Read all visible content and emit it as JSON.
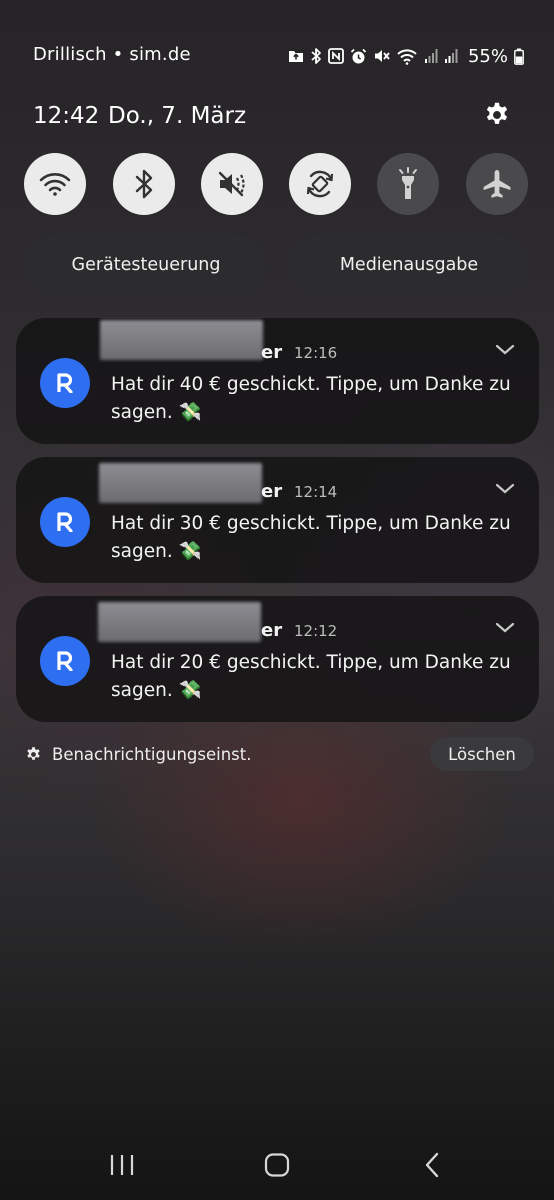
{
  "status_bar": {
    "carrier": "Drillisch • sim.de",
    "battery": "55%",
    "icons": [
      "notification-app-icon",
      "bluetooth-icon",
      "nfc-icon",
      "alarm-icon",
      "mute-icon",
      "wifi-icon",
      "signal-icon",
      "signal-icon",
      "battery-icon"
    ]
  },
  "header": {
    "time": "12:42",
    "date": "Do., 7. März",
    "settings_icon": "gear-icon"
  },
  "quick_settings": [
    {
      "name": "wifi",
      "icon": "wifi-icon",
      "on": true
    },
    {
      "name": "bluetooth",
      "icon": "bluetooth-icon",
      "on": true
    },
    {
      "name": "sound",
      "icon": "mute-icon",
      "on": true
    },
    {
      "name": "auto-rotate",
      "icon": "rotate-icon",
      "on": true
    },
    {
      "name": "flashlight",
      "icon": "flashlight-icon",
      "on": false
    },
    {
      "name": "airplane-mode",
      "icon": "airplane-icon",
      "on": false
    }
  ],
  "controls": {
    "device_control": "Gerätesteuerung",
    "media_output": "Medienausgabe"
  },
  "notifications": [
    {
      "sender_suffix": "er",
      "time": "12:16",
      "message": "Hat dir 40 € geschickt. Tippe, um Danke zu sagen. 💸"
    },
    {
      "sender_suffix": "er",
      "time": "12:14",
      "message": "Hat dir 30 € geschickt. Tippe, um Danke zu sagen. 💸"
    },
    {
      "sender_suffix": "er",
      "time": "12:12",
      "message": "Hat dir 20 € geschickt. Tippe, um Danke zu sagen. 💸"
    }
  ],
  "footer": {
    "notification_settings": "Benachrichtigungseinst.",
    "clear": "Löschen"
  },
  "navigation": [
    "recent-apps-icon",
    "home-icon",
    "back-icon"
  ],
  "colors": {
    "toggle_on": "#ebebeb",
    "toggle_off": "#4a4a4c",
    "app_icon": "#2e6ef0"
  }
}
